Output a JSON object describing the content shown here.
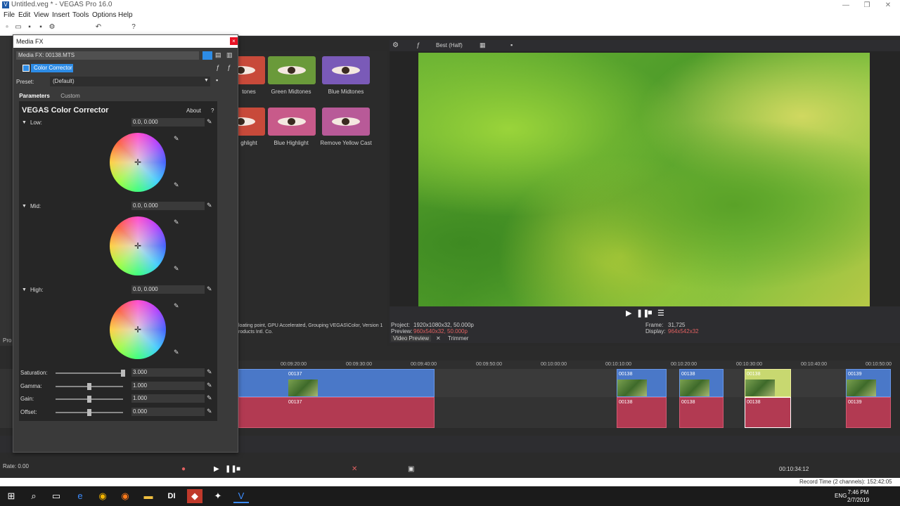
{
  "app": {
    "title": "Untitled.veg * - VEGAS Pro 16.0",
    "icon_letter": "V",
    "minimize": "—",
    "maximize": "❐",
    "close": "✕"
  },
  "menu": [
    "File",
    "Edit",
    "View",
    "Insert",
    "Tools",
    "Options",
    "Help"
  ],
  "media_fx": {
    "window_title": "Media FX",
    "close_symbol": "×",
    "chain_label": "Media FX: 00138.MTS",
    "plugin_name": "Color Corrector",
    "preset_label": "Preset:",
    "preset_value": "(Default)",
    "tabs": [
      "Parameters",
      "Custom"
    ],
    "panel_title": "VEGAS Color Corrector",
    "about": "About",
    "help": "?",
    "low_label": "Low:",
    "low_value": "0.0, 0.000",
    "mid_label": "Mid:",
    "mid_value": "0.0, 0.000",
    "high_label": "High:",
    "high_value": "0.0, 0.000",
    "saturation_label": "Saturation:",
    "saturation_value": "3.000",
    "gamma_label": "Gamma:",
    "gamma_value": "1.000",
    "gain_label": "Gain:",
    "gain_value": "1.000",
    "offset_label": "Offset:",
    "offset_value": "0.000",
    "saturation_level": 1.0,
    "gamma_level": 0.5,
    "gain_level": 0.5,
    "offset_level": 0.5
  },
  "fx_presets": [
    {
      "label": "tones",
      "tint": "#c84a3a"
    },
    {
      "label": "Green Midtones",
      "tint": "#6a9a3a"
    },
    {
      "label": "Blue Midtones",
      "tint": "#7a5ab8"
    },
    {
      "label": "ghlight",
      "tint": "#c84a3a"
    },
    {
      "label": "Blue Highlight",
      "tint": "#c85a8a"
    },
    {
      "label": "Remove Yellow Cast",
      "tint": "#b85a98"
    }
  ],
  "preview": {
    "quality": "Best (Half)",
    "project_label": "Project:",
    "project_value": "1920x1080x32, 50.000p",
    "preview_label": "Preview:",
    "preview_value": "960x540x32, 50.000p",
    "frame_label": "Frame:",
    "frame_value": "31,725",
    "display_label": "Display:",
    "display_value": "964x542x32",
    "tab_video_preview": "Video Preview",
    "tab_trimmer": "Trimmer",
    "fx_info_line1": "loating point, GPU Accelerated, Grouping VEGAS\\Color, Version 1",
    "fx_info_line2": "roducts Intl. Co."
  },
  "timeline": {
    "ruler_ticks": [
      "00:09:20:00",
      "00:09:30:00",
      "00:09:40:00",
      "00:09:50:00",
      "00:10:00:00",
      "00:10:10:00",
      "00:10:20:00",
      "00:10:30:00",
      "00:10:40:00",
      "00:10:50:00"
    ],
    "video_clips": [
      "00137",
      "00138",
      "00138",
      "00138",
      "00139"
    ],
    "audio_clips": [
      "00137",
      "00138",
      "00138",
      "00138",
      "00139"
    ],
    "rate": "Rate: 0.00",
    "cursor_time": "00:10:34:12",
    "record_time": "Record Time (2 channels): 152:42:05",
    "left_label": "Pro"
  },
  "taskbar": {
    "time": "7:46 PM",
    "date": "2/7/2019",
    "lang": "ENG"
  }
}
